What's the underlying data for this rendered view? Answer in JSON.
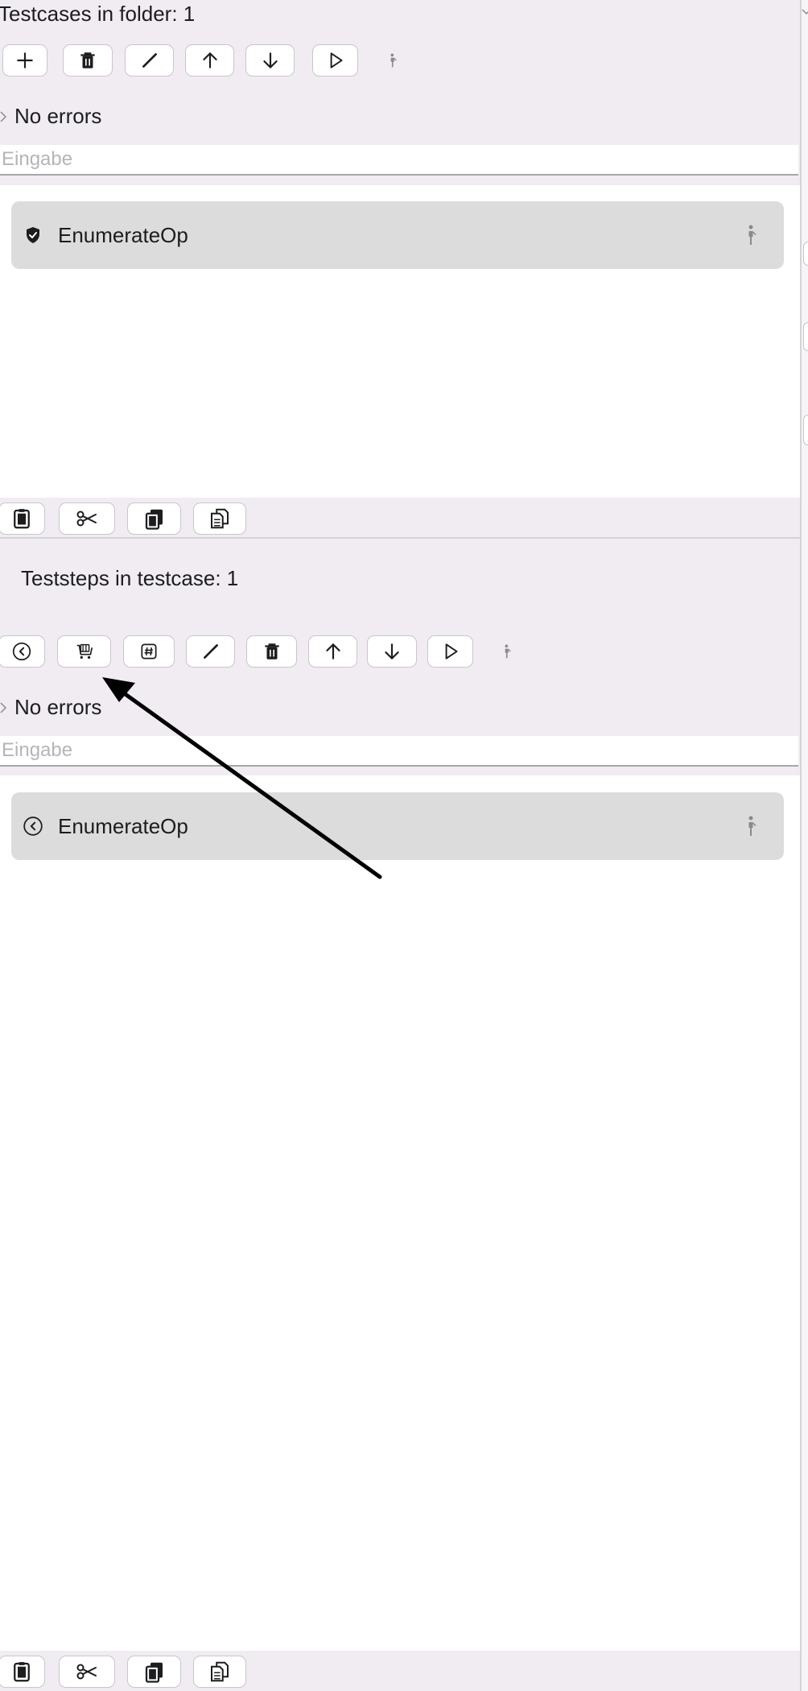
{
  "testcases": {
    "title": "Testcases in folder: 1",
    "toolbar": {
      "add_icon": "plus-icon",
      "delete_icon": "trash-icon",
      "edit_icon": "pencil-icon",
      "move_up_icon": "arrow-up-icon",
      "move_down_icon": "arrow-down-icon",
      "run_icon": "play-icon",
      "person_icon": "person-icon"
    },
    "errors_label": "No errors",
    "search_placeholder": "Eingabe",
    "items": [
      {
        "label": "EnumerateOp",
        "icon": "shield-check-icon"
      }
    ]
  },
  "teststeps": {
    "title": "Teststeps in testcase: 1",
    "toolbar": {
      "back_icon": "circle-left-icon",
      "cart_icon": "shopping-cart-icon",
      "hash_icon": "number-sign-icon",
      "edit_icon": "pencil-icon",
      "delete_icon": "trash-icon",
      "move_up_icon": "arrow-up-icon",
      "move_down_icon": "arrow-down-icon",
      "run_icon": "play-icon",
      "person_icon": "person-icon"
    },
    "errors_label": "No errors",
    "search_placeholder": "Eingabe",
    "items": [
      {
        "label": "EnumerateOp",
        "icon": "circle-left-icon"
      }
    ]
  },
  "clipboard_bar": {
    "paste_icon": "clipboard-icon",
    "cut_icon": "scissors-icon",
    "copy_icon": "copy-icon",
    "duplicate_icon": "document-copy-icon"
  },
  "annotation": {
    "arrow_icon": "annotation-arrow-icon"
  },
  "colors": {
    "panel_background": "#f0ecf2",
    "row_background": "#dcdcdc",
    "text": "#1d1d1f",
    "placeholder": "#b6b4b8"
  }
}
